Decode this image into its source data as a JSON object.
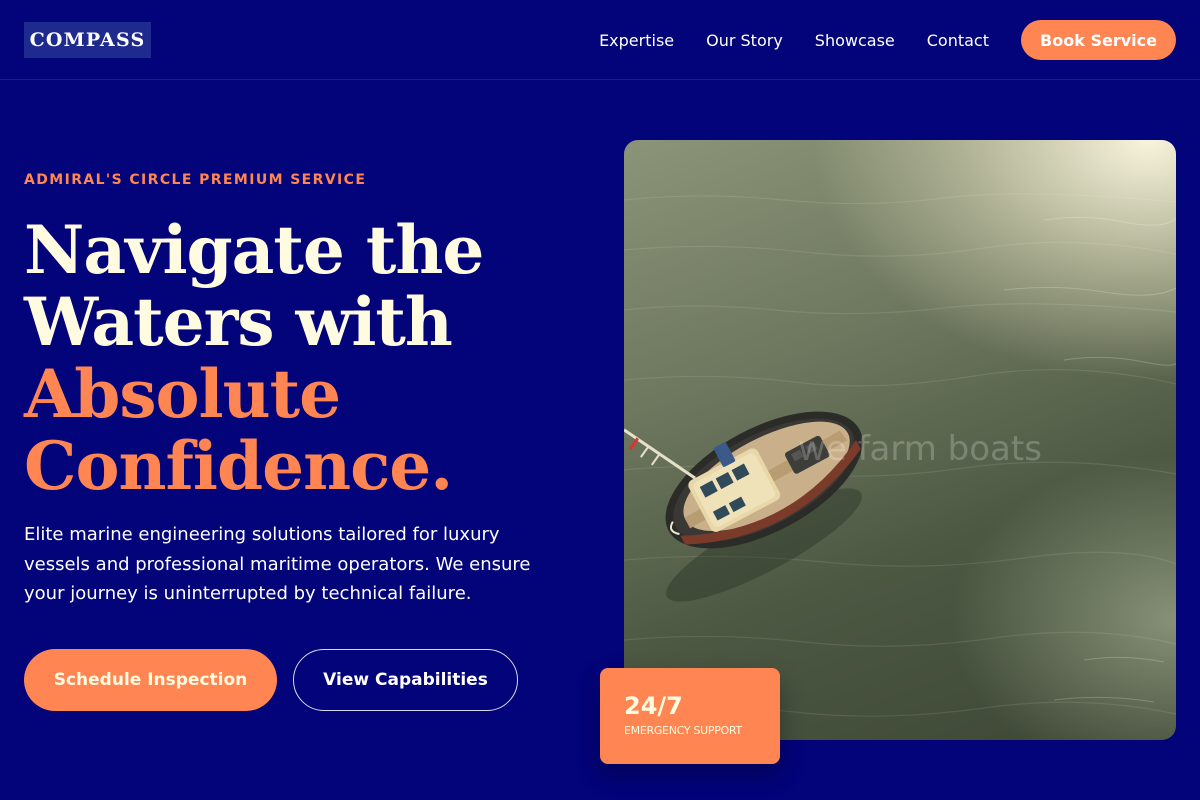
{
  "header": {
    "logo": "COMPASS",
    "nav": [
      {
        "label": "Expertise"
      },
      {
        "label": "Our Story"
      },
      {
        "label": "Showcase"
      },
      {
        "label": "Contact"
      }
    ],
    "cta_label": "Book Service"
  },
  "hero": {
    "eyebrow": "ADMIRAL'S CIRCLE PREMIUM SERVICE",
    "headline": {
      "line1": "Navigate the",
      "line2": "Waters with",
      "line3": "Absolute",
      "line4": "Confidence."
    },
    "description": "Elite marine engineering solutions tailored for luxury vessels and professional maritime operators. We ensure your journey is uninterrupted by technical failure.",
    "primary_cta": "Schedule Inspection",
    "secondary_cta": "View Capabilities"
  },
  "image": {
    "watermark": "we farm boats"
  },
  "support_card": {
    "value": "24/7",
    "label": "EMERGENCY SUPPORT"
  },
  "colors": {
    "background": "#03037a",
    "accent": "#ff8552",
    "cream": "#fffbe0"
  }
}
